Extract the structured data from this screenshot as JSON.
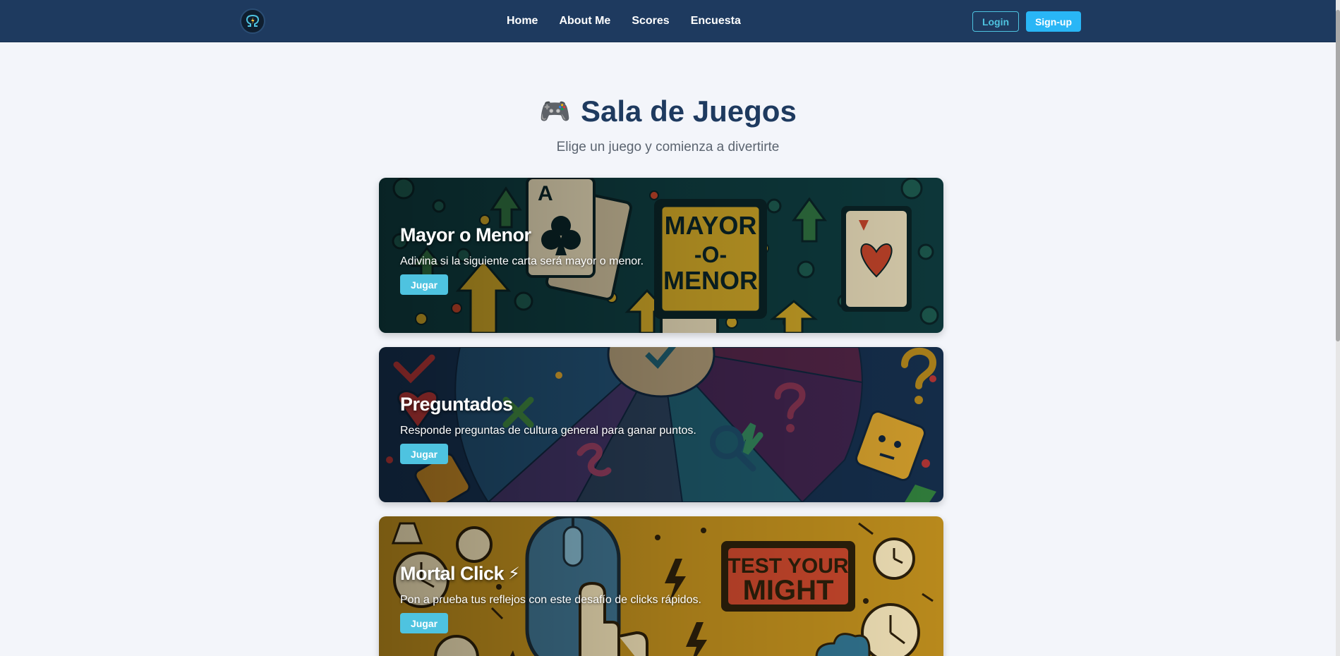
{
  "nav": {
    "logo_icon": "omega-lightning-logo",
    "links": [
      "Home",
      "About Me",
      "Scores",
      "Encuesta"
    ],
    "login_label": "Login",
    "signup_label": "Sign-up"
  },
  "header": {
    "icon": "🎮",
    "title": "Sala de Juegos",
    "subtitle": "Elige un juego y comienza a divertirte"
  },
  "games": [
    {
      "title": "Mayor o Menor",
      "description": "Adivina si la siguiente carta será mayor o menor.",
      "button": "Jugar",
      "image_text": [
        "MAYOR",
        "-O-",
        "MENOR"
      ],
      "color": "#0f3b3e"
    },
    {
      "title": "Preguntados",
      "description": "Responde preguntas de cultura general para ganar puntos.",
      "button": "Jugar",
      "color": "#142c48"
    },
    {
      "title": "Mortal Click",
      "title_icon": "⚡",
      "description": "Pon a prueba tus reflejos con este desafío de clicks rápidos.",
      "button": "Jugar",
      "image_text": [
        "TEST YOUR",
        "MIGHT"
      ],
      "color": "#b8891c"
    }
  ],
  "colors": {
    "navbar": "#1e3a5f",
    "accent": "#4ec3e0",
    "signup": "#29b6f6",
    "title": "#1e3a5f",
    "background": "#f3f5fa"
  }
}
